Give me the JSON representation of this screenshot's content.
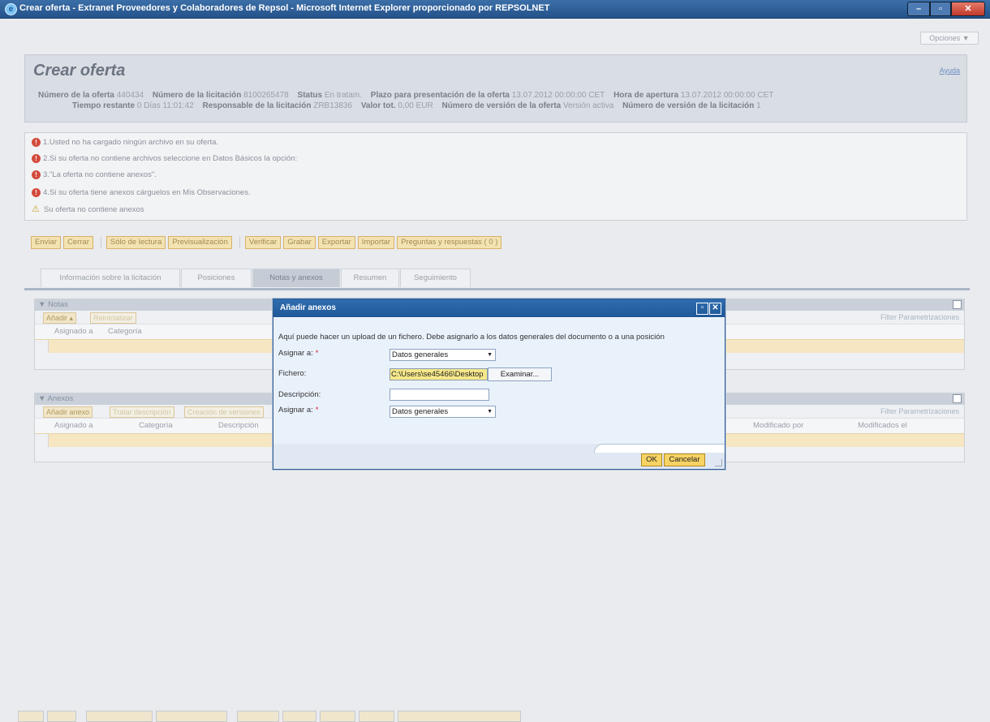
{
  "window": {
    "title": "Crear oferta - Extranet Proveedores y Colaboradores de Repsol - Microsoft Internet Explorer proporcionado por REPSOLNET"
  },
  "opciones_label": "Opciones ▼",
  "header": {
    "title": "Crear oferta",
    "help": "Ayuda",
    "row1": [
      {
        "label": "Número de la oferta",
        "value": "440434"
      },
      {
        "label": "Número de la licitación",
        "value": "8100265478"
      },
      {
        "label": "Status",
        "value": "En tratam."
      },
      {
        "label": "Plazo para presentación de la oferta",
        "value": "13.07.2012 00:00:00 CET"
      },
      {
        "label": "Hora de apertura",
        "value": "13.07.2012 00:00:00 CET"
      }
    ],
    "row2": [
      {
        "label": "Tiempo restante",
        "value": "0 Días 11:01:42"
      },
      {
        "label": "Responsable de la licitación",
        "value": "ZRB13836"
      },
      {
        "label": "Valor tot.",
        "value": "0,00 EUR"
      },
      {
        "label": "Número de versión de la oferta",
        "value": "Versión activa"
      },
      {
        "label": "Número de versión de la licitación",
        "value": "1"
      }
    ]
  },
  "messages": [
    {
      "type": "error",
      "text": "1.Usted no ha cargado ningún archivo en su oferta."
    },
    {
      "type": "error",
      "text": "2.Si su oferta no contiene archivos seleccione en Datos Básicos la opción:"
    },
    {
      "type": "error",
      "text": "3.\"La oferta no contiene anexos\"."
    },
    {
      "type": "error",
      "text": "4.Si su oferta tiene anexos cárguelos en Mis Observaciones."
    },
    {
      "type": "warning",
      "text": "Su oferta no contiene anexos"
    }
  ],
  "toolbar": {
    "enviar": "Enviar",
    "cerrar": "Cerrar",
    "solo_lectura": "Sólo de lectura",
    "previsualizacion": "Previsualización",
    "verificar": "Verificar",
    "grabar": "Grabar",
    "exportar": "Exportar",
    "importar": "Importar",
    "preguntas": "Preguntas y respuestas ( 0 )"
  },
  "tabs": [
    "Información sobre la licitación",
    "Posiciones",
    "Notas y anexos",
    "Resumen",
    "Seguimiento"
  ],
  "notas": {
    "title": "▼ Notas",
    "add": "Añadir ▴",
    "reinit": "Reinicializar",
    "links": "Filter  Parametrizaciones",
    "cols": [
      "Asignado a",
      "Categoría"
    ]
  },
  "anexos": {
    "title": "▼ Anexos",
    "add": "Añadir anexo",
    "tratar": "Tratar descripción",
    "creacion": "Creación de versiones",
    "links": "Filter  Parametrizaciones",
    "cols": [
      "Asignado a",
      "Categoría",
      "Descripción",
      "Modificado por",
      "Modificados el"
    ]
  },
  "dialog": {
    "title": "Añadir anexos",
    "intro": "Aquí puede hacer un upload de un fichero. Debe asignarlo a los datos generales del documento o a una posición",
    "asignar_label": "Asignar a:",
    "asignar_value": "Datos generales",
    "fichero_label": "Fichero:",
    "fichero_value": "C:\\Users\\se45466\\Desktop",
    "examinar": "Examinar...",
    "descripcion_label": "Descripción:",
    "asignar2_label": "Asignar a:",
    "asignar2_value": "Datos generales",
    "ok": "OK",
    "cancelar": "Cancelar"
  }
}
